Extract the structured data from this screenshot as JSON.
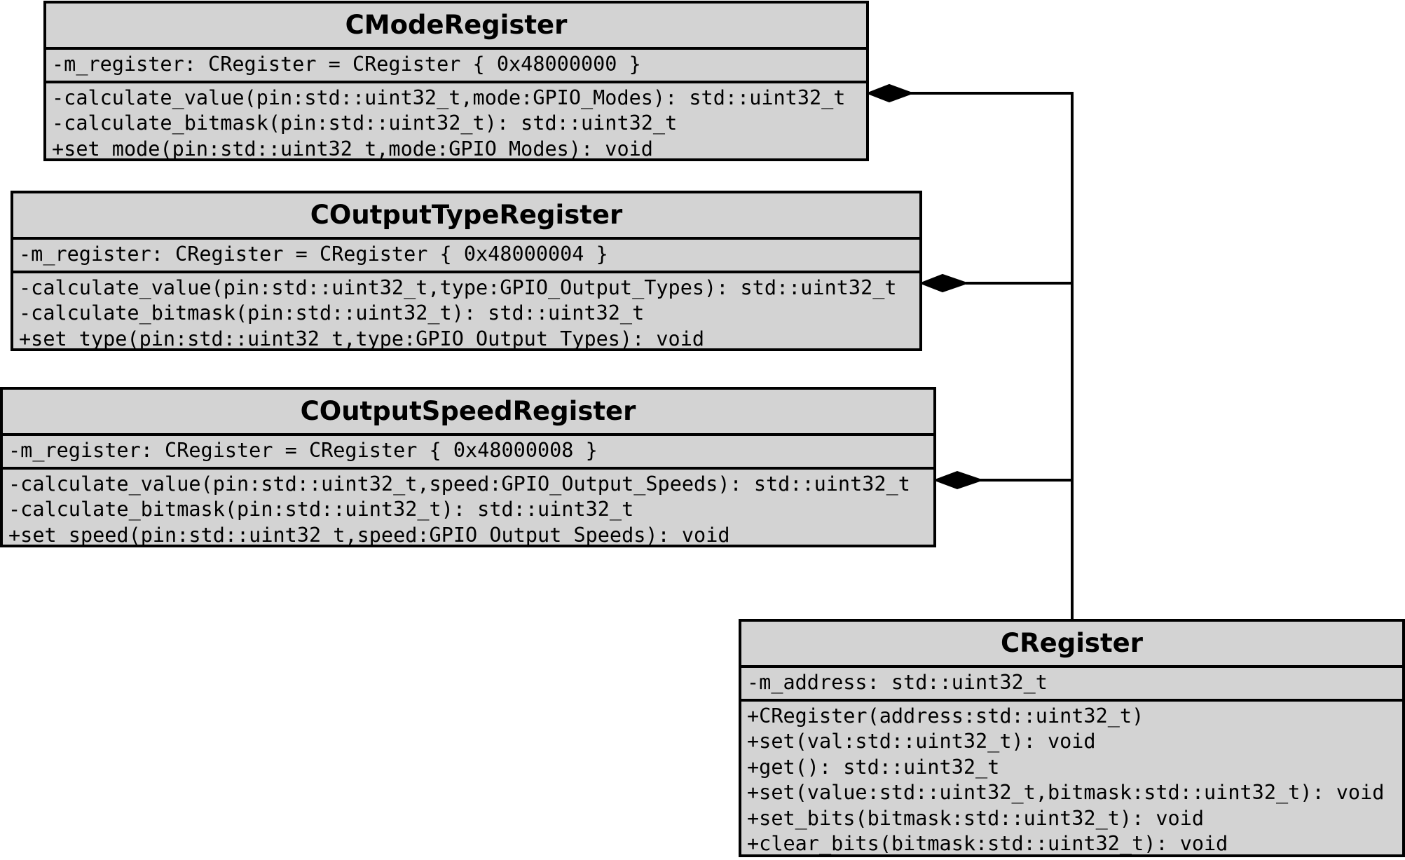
{
  "diagram": {
    "classes": {
      "mode_register": {
        "name": "CModeRegister",
        "attributes": [
          "-m_register: CRegister = CRegister { 0x48000000 }"
        ],
        "operations": [
          "-calculate_value(pin:std::uint32_t,mode:GPIO_Modes): std::uint32_t",
          "-calculate_bitmask(pin:std::uint32_t): std::uint32_t",
          "+set_mode(pin:std::uint32_t,mode:GPIO_Modes): void"
        ]
      },
      "output_type_register": {
        "name": "COutputTypeRegister",
        "attributes": [
          "-m_register: CRegister = CRegister { 0x48000004 }"
        ],
        "operations": [
          "-calculate_value(pin:std::uint32_t,type:GPIO_Output_Types): std::uint32_t",
          "-calculate_bitmask(pin:std::uint32_t): std::uint32_t",
          "+set_type(pin:std::uint32_t,type:GPIO_Output_Types): void"
        ]
      },
      "output_speed_register": {
        "name": "COutputSpeedRegister",
        "attributes": [
          "-m_register: CRegister = CRegister { 0x48000008 }"
        ],
        "operations": [
          "-calculate_value(pin:std::uint32_t,speed:GPIO_Output_Speeds): std::uint32_t",
          "-calculate_bitmask(pin:std::uint32_t): std::uint32_t",
          "+set_speed(pin:std::uint32_t,speed:GPIO_Output_Speeds): void"
        ]
      },
      "register": {
        "name": "CRegister",
        "attributes": [
          "-m_address: std::uint32_t"
        ],
        "operations": [
          "+CRegister(address:std::uint32_t)",
          "+set(val:std::uint32_t): void",
          "+get(): std::uint32_t",
          "+set(value:std::uint32_t,bitmask:std::uint32_t): void",
          "+set_bits(bitmask:std::uint32_t): void",
          "+clear_bits(bitmask:std::uint32_t): void"
        ]
      }
    },
    "relations": [
      {
        "type": "composition",
        "whole": "CModeRegister",
        "part": "CRegister"
      },
      {
        "type": "composition",
        "whole": "COutputTypeRegister",
        "part": "CRegister"
      },
      {
        "type": "composition",
        "whole": "COutputSpeedRegister",
        "part": "CRegister"
      }
    ],
    "colors": {
      "box_fill": "#d3d3d3",
      "stroke": "#000000",
      "background": "#ffffff"
    }
  }
}
